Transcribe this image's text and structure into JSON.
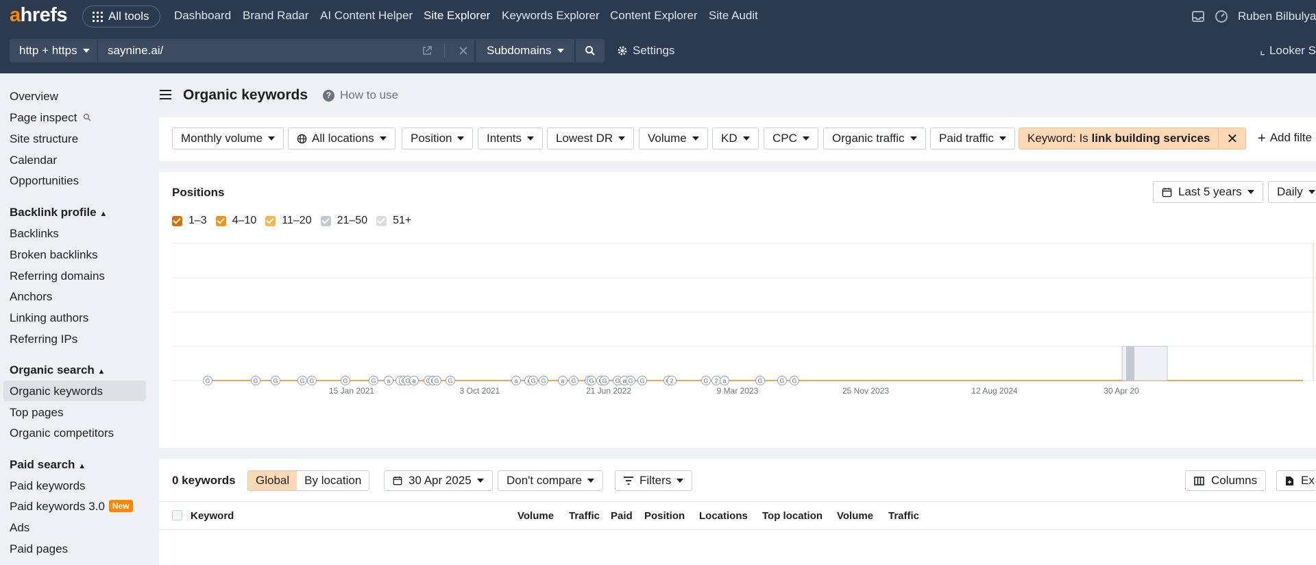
{
  "topbar": {
    "logo_prefix": "a",
    "logo_rest": "hrefs",
    "all_tools": "All tools",
    "nav": [
      "Dashboard",
      "Brand Radar",
      "AI Content Helper",
      "Site Explorer",
      "Keywords Explorer",
      "Content Explorer",
      "Site Audit"
    ],
    "active_nav": "Site Explorer",
    "user": "Ruben Bilbulya"
  },
  "urlbar": {
    "protocol": "http + https",
    "url": "saynine.ai/",
    "mode": "Subdomains",
    "settings": "Settings",
    "looker": "Looker S"
  },
  "sidebar": {
    "items_top": [
      "Overview",
      "Page inspect",
      "Site structure",
      "Calendar",
      "Opportunities"
    ],
    "backlink_head": "Backlink profile",
    "backlink_items": [
      "Backlinks",
      "Broken backlinks",
      "Referring domains",
      "Anchors",
      "Linking authors",
      "Referring IPs"
    ],
    "organic_head": "Organic search",
    "organic_items": [
      "Organic keywords",
      "Top pages",
      "Organic competitors"
    ],
    "paid_head": "Paid search",
    "paid_items": [
      "Paid keywords",
      "Paid keywords 3.0",
      "Ads",
      "Paid pages"
    ],
    "new_badge": "New"
  },
  "page": {
    "title": "Organic keywords",
    "how_to_use": "How to use"
  },
  "filters": {
    "chips": [
      "Monthly volume",
      "All locations",
      "Position",
      "Intents",
      "Lowest DR",
      "Volume",
      "KD",
      "CPC",
      "Organic traffic",
      "Paid traffic"
    ],
    "keyword_prefix": "Keyword: Is ",
    "keyword_value": "link building services",
    "add_filter": "Add filte"
  },
  "positions": {
    "title": "Positions",
    "range": "Last 5 years",
    "interval": "Daily",
    "legend": [
      {
        "label": "1–3",
        "color": "#d96f0b",
        "checked": true
      },
      {
        "label": "4–10",
        "color": "#f29416",
        "checked": true
      },
      {
        "label": "11–20",
        "color": "#f7b54f",
        "checked": true
      },
      {
        "label": "21–50",
        "color": "#c3c9d2",
        "checked": true
      },
      {
        "label": "51+",
        "color": "#d9dde3",
        "checked": true
      }
    ]
  },
  "chart_data": {
    "type": "area",
    "title": "Positions",
    "x_ticks": [
      "15 Jan 2021",
      "3 Oct 2021",
      "21 Jun 2022",
      "9 Mar 2023",
      "25 Nov 2023",
      "12 Aug 2024",
      "30 Apr 20"
    ],
    "x_range": [
      "2020-05-01",
      "2025-04-30"
    ],
    "ylim": [
      0,
      1
    ],
    "series": [
      {
        "name": "1–3",
        "values": [
          0
        ]
      },
      {
        "name": "4–10",
        "values": [
          0
        ]
      },
      {
        "name": "11–20",
        "values": [
          0
        ]
      },
      {
        "name": "21–50",
        "values": [
          0
        ]
      },
      {
        "name": "51+",
        "values": [
          0
        ]
      }
    ],
    "annotations": [
      "G",
      "G",
      "G",
      "G",
      "G",
      "G",
      "G",
      "a",
      "a",
      "G",
      "G",
      "a",
      "G",
      "G",
      "G",
      "G",
      "a",
      "a",
      "G",
      "G",
      "a",
      "G",
      "G",
      "G",
      "G",
      "G",
      "G",
      "a",
      "G",
      "G",
      "G",
      "2",
      "G",
      "2",
      "a",
      "G",
      "G",
      "G"
    ],
    "grid": true
  },
  "keywords": {
    "count": "0 keywords",
    "seg_global": "Global",
    "seg_location": "By location",
    "date": "30 Apr 2025",
    "compare": "Don't compare",
    "filters": "Filters",
    "columns": "Columns",
    "export": "Ex",
    "headers": [
      "Keyword",
      "Volume",
      "Traffic",
      "Paid",
      "Position",
      "Locations",
      "Top location",
      "Volume",
      "Traffic"
    ]
  }
}
